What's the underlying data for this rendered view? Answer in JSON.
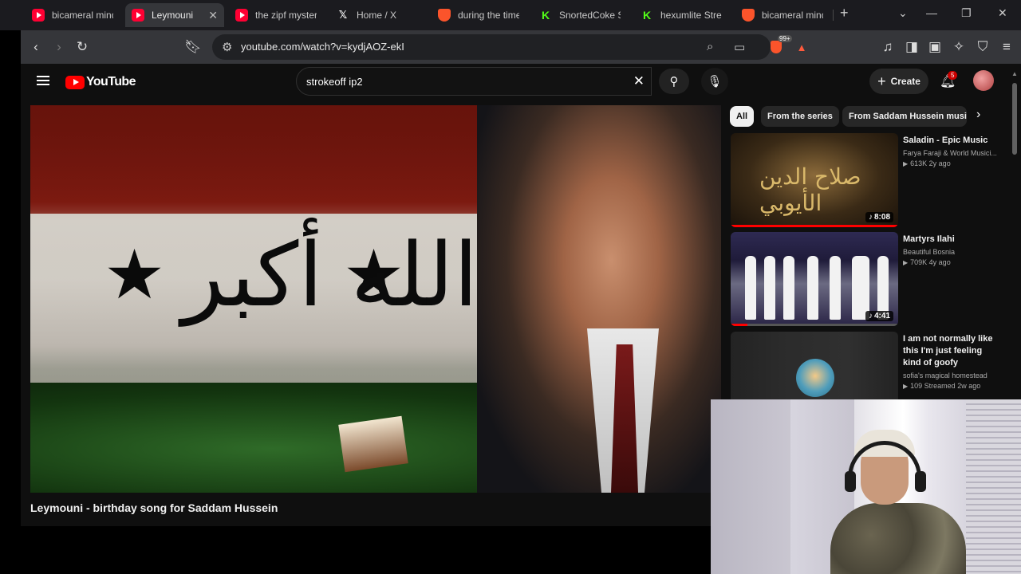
{
  "browser": {
    "tabs": [
      {
        "title": "bicameral mind",
        "favicon": "youtube-icon",
        "active": false
      },
      {
        "title": "Leymouni",
        "favicon": "youtube-icon",
        "active": true
      },
      {
        "title": "the zipf mystery",
        "favicon": "youtube-icon",
        "active": false
      },
      {
        "title": "Home / X",
        "favicon": "x-icon",
        "active": false
      },
      {
        "title": "during the time",
        "favicon": "brave-icon",
        "active": false
      },
      {
        "title": "SnortedCoke S",
        "favicon": "kick-icon",
        "active": false
      },
      {
        "title": "hexumlite Stre",
        "favicon": "kick-icon",
        "active": false
      },
      {
        "title": "bicameral mind",
        "favicon": "brave-icon",
        "active": false
      }
    ],
    "new_tab_symbol": "+",
    "url": "youtube.com/watch?v=kydjAOZ-ekI",
    "extension_badge": "99+"
  },
  "youtube": {
    "logo_text": "YouTube",
    "search_query": "strokeoff ip2",
    "create_label": "Create",
    "notification_count": "5",
    "chips": [
      "All",
      "From the series",
      "From Saddam Hussein music"
    ],
    "video": {
      "title": "Leymouni - birthday song for Saddam Hussein",
      "flag_script": "الله أكبر"
    },
    "recommendations": [
      {
        "title": "Saladin - Epic Music",
        "channel": "Farya Faraji & World Musici...",
        "stats": "613K  2y ago",
        "duration": "8:08",
        "thumb_text": "صلاح الدين الأيوبي",
        "watched_fraction": 1.0
      },
      {
        "title": "Martyrs Ilahi",
        "channel": "Beautiful Bosnia",
        "stats": "709K  4y ago",
        "duration": "4:41",
        "watched_fraction": 0.1
      },
      {
        "title": "I am not normally like this I'm just feeling kind of goofy",
        "channel": "sofia's magical homestead",
        "stats": "109  Streamed 2w ago",
        "duration": ""
      }
    ]
  },
  "colors": {
    "youtube_red": "#ff0000",
    "page_bg": "#0f0f0f",
    "chip_bg": "#272727",
    "tab_active_bg": "#35363a"
  }
}
